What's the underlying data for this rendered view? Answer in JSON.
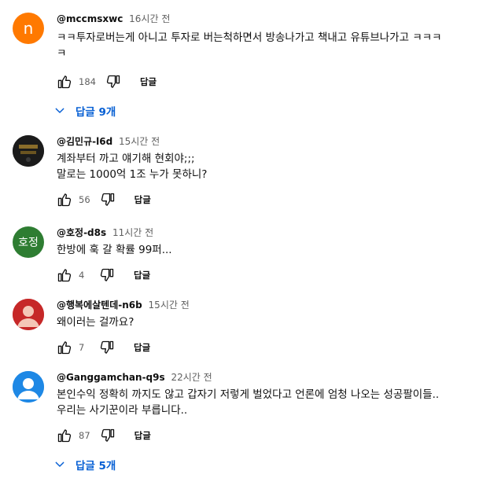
{
  "comments": [
    {
      "author": "@mccmsxwc",
      "time": "16시간 전",
      "text": "ㅋㅋ투자로버는게 아니고 투자로 버는척하면서 방송나가고 책내고 유튜브나가고 ㅋㅋㅋ\nㅋ",
      "likes": "184",
      "reply_label": "답글",
      "avatar_letter": "n",
      "avatar_color": "#ff7900",
      "replies_label": "답글 9개"
    },
    {
      "author": "@김민규-l6d",
      "time": "15시간 전",
      "text": "계좌부터 까고 얘기해 현회야;;;\n말로는 1000억 1조 누가 못하니?",
      "likes": "56",
      "reply_label": "답글",
      "avatar_color": "#1e1e1e"
    },
    {
      "author": "@호정-d8s",
      "time": "11시간 전",
      "text": "한방에 훅 갈 확률 99퍼...",
      "likes": "4",
      "reply_label": "답글",
      "avatar_letter": "호정",
      "avatar_color": "#2e7d32"
    },
    {
      "author": "@행복에살텐데-n6b",
      "time": "15시간 전",
      "text": "왜이러는 걸까요?",
      "likes": "7",
      "reply_label": "답글",
      "avatar_color": "#c62828"
    },
    {
      "author": "@Ganggamchan-q9s",
      "time": "22시간 전",
      "text": "본인수익 정확히 까지도 않고 갑자기 저렇게 벌었다고 언론에 엄청 나오는 성공팔이들..\n우리는 사기꾼이라 부릅니다..",
      "likes": "87",
      "reply_label": "답글",
      "avatar_color": "#1e88e5",
      "replies_label": "답글 5개"
    }
  ],
  "icons": {
    "like": "thumbs-up-icon",
    "dislike": "thumbs-down-icon",
    "expand": "chevron-down-icon"
  },
  "colors": {
    "link": "#065fd4",
    "meta": "#606060"
  }
}
